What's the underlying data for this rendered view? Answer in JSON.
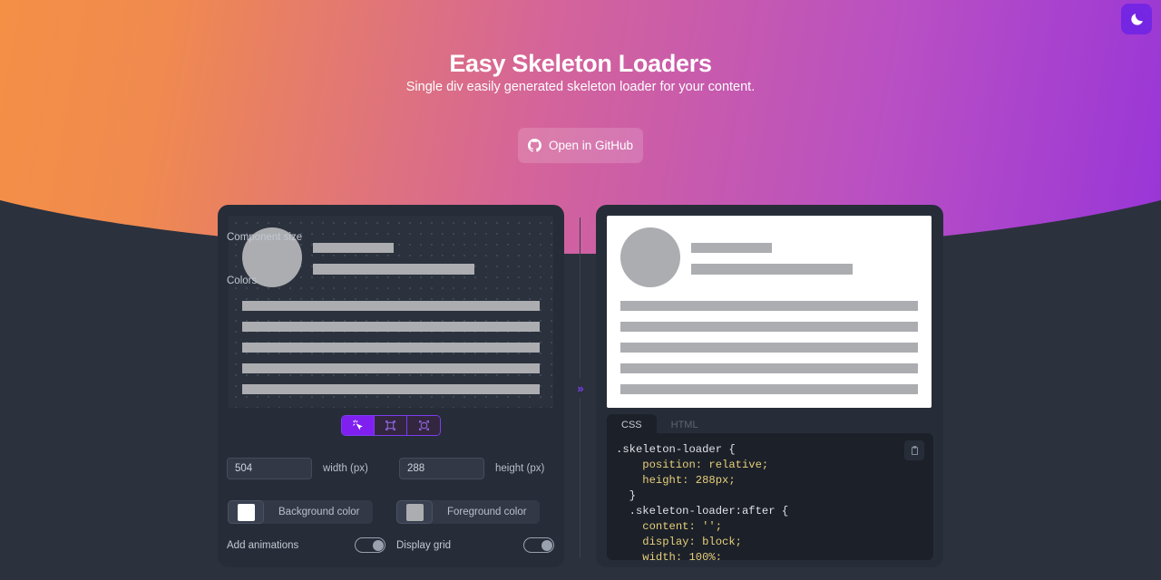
{
  "header": {
    "title": "Easy Skeleton Loaders",
    "subtitle": "Single div easily generated skeleton loader for your content.",
    "github_button": "Open in GitHub",
    "theme_toggle_icon": "moon-icon"
  },
  "divider": {
    "arrow": "»"
  },
  "editor": {
    "tools": [
      {
        "name": "magic-cursor-tool",
        "active": true
      },
      {
        "name": "rectangle-tool",
        "active": false
      },
      {
        "name": "circle-tool",
        "active": false
      }
    ],
    "component_size": {
      "label": "Component size",
      "width_value": "504",
      "width_unit": "width (px)",
      "height_value": "288",
      "height_unit": "height (px)"
    },
    "colors": {
      "label": "Colors",
      "background_label": "Background color",
      "background_value": "#ffffff",
      "foreground_label": "Foreground color",
      "foreground_value": "#abadb1"
    },
    "toggles": {
      "animations_label": "Add animations",
      "animations_on": true,
      "grid_label": "Display grid",
      "grid_on": true
    }
  },
  "code_panel": {
    "tabs": [
      {
        "label": "CSS",
        "active": true
      },
      {
        "label": "HTML",
        "active": false
      }
    ],
    "copy_icon": "clipboard-icon",
    "lines": [
      {
        "text": ".skeleton-loader {",
        "kind": "sel"
      },
      {
        "text": "    position: relative;",
        "kind": "prop"
      },
      {
        "text": "    height: 288px;",
        "kind": "prop"
      },
      {
        "text": "  }",
        "kind": "sel"
      },
      {
        "text": "  .skeleton-loader:after {",
        "kind": "sel"
      },
      {
        "text": "    content: '';",
        "kind": "prop"
      },
      {
        "text": "    display: block;",
        "kind": "prop"
      },
      {
        "text": "    width: 100%;",
        "kind": "prop"
      }
    ]
  },
  "colors": {
    "accent": "#7b3ef0",
    "theme_btn": "#7526e3",
    "page_bg": "#2b313d",
    "card_bg": "#272d38",
    "skeleton_fg": "#abadb1",
    "gradient_start": "#f7943e",
    "gradient_end": "#8b2ae0"
  }
}
